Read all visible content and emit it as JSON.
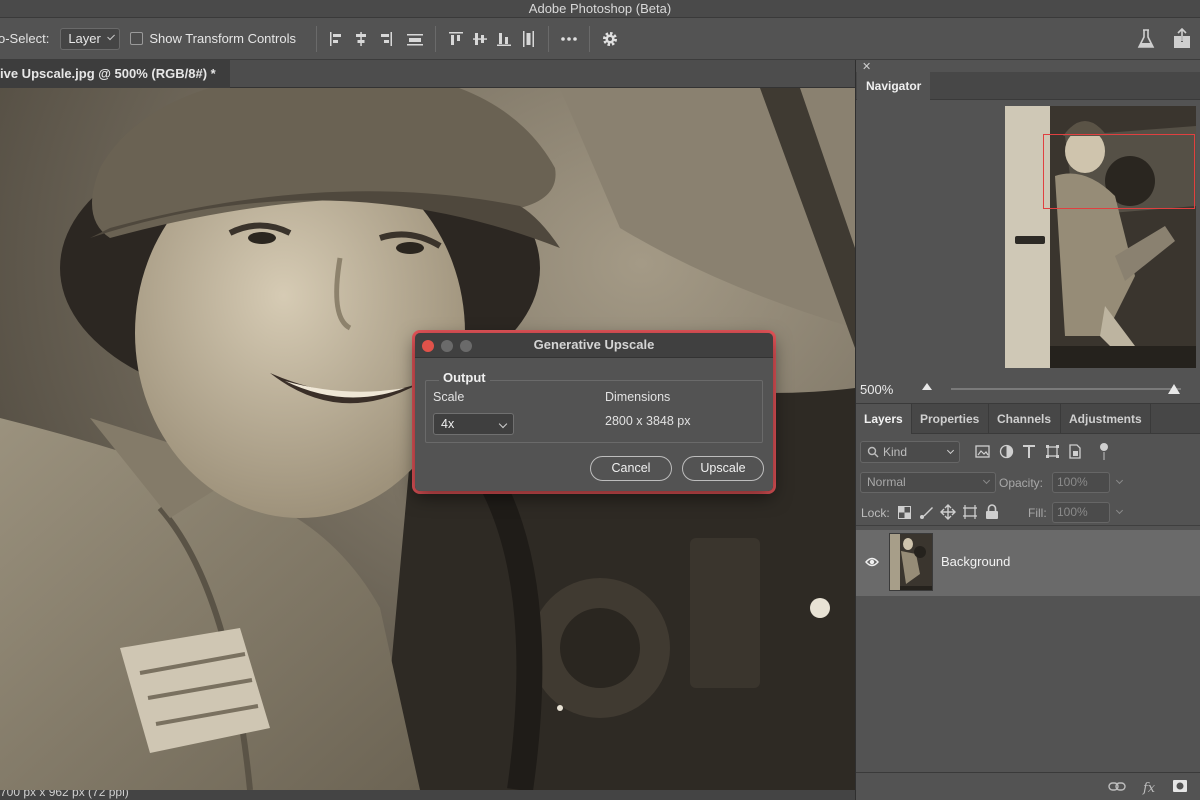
{
  "app": {
    "title": "Adobe Photoshop (Beta)"
  },
  "options_bar": {
    "auto_select_label": "o-Select:",
    "auto_select_value": "Layer",
    "transform_controls_label": "Show Transform Controls"
  },
  "document": {
    "tab_title": "ive Upscale.jpg @ 500% (RGB/8#) *",
    "status": "700 px x 962 px (72 ppi)"
  },
  "navigator": {
    "tab": "Navigator",
    "zoom": "500%"
  },
  "layers_panel": {
    "tabs": [
      "Layers",
      "Properties",
      "Channels",
      "Adjustments"
    ],
    "filter_kind": "Kind",
    "blend_mode": "Normal",
    "opacity_label": "Opacity:",
    "opacity_value": "100%",
    "lock_label": "Lock:",
    "fill_label": "Fill:",
    "fill_value": "100%",
    "layers": [
      {
        "name": "Background"
      }
    ]
  },
  "dialog": {
    "title": "Generative Upscale",
    "group_title": "Output",
    "scale_label": "Scale",
    "scale_value": "4x",
    "dimensions_label": "Dimensions",
    "dimensions_value": "2800 x 3848 px",
    "cancel_label": "Cancel",
    "confirm_label": "Upscale"
  },
  "colors": {
    "highlight": "#e8555a",
    "navigator_frame": "#e04040",
    "close_dot": "#e0524a",
    "panel_bg": "#535353"
  }
}
